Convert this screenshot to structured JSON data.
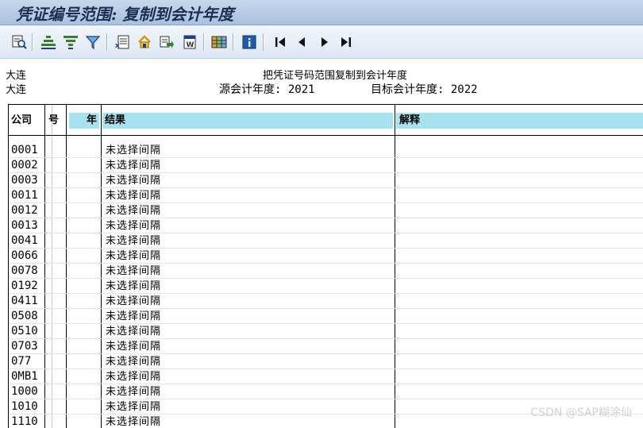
{
  "window": {
    "title": "凭证编号范围: 复制到会计年度"
  },
  "toolbar": {
    "buttons": [
      {
        "icon": "display-details-icon"
      },
      {
        "icon": "sort-ascending-icon"
      },
      {
        "icon": "sort-descending-icon"
      },
      {
        "icon": "filter-icon"
      },
      {
        "icon": "export-spreadsheet-icon"
      },
      {
        "icon": "local-file-icon"
      },
      {
        "icon": "send-icon"
      },
      {
        "icon": "word-processing-icon"
      },
      {
        "icon": "change-layout-icon"
      },
      {
        "icon": "information-icon"
      },
      {
        "icon": "first-page-icon"
      },
      {
        "icon": "previous-page-icon"
      },
      {
        "icon": "next-page-icon"
      },
      {
        "icon": "last-page-icon"
      }
    ]
  },
  "report": {
    "company_line1": "大连",
    "company_line2": "大连",
    "heading": "把凭证号码范围复制到会计年度",
    "source_year_label": "源会计年度:",
    "source_year": "2021",
    "target_year_label": "目标会计年度:",
    "target_year": "2022"
  },
  "table": {
    "columns": {
      "company": "公司",
      "number": "号",
      "year": "年",
      "result": "结果",
      "explanation": "解释"
    },
    "rows": [
      {
        "company": "0001",
        "result": "未选择间隔"
      },
      {
        "company": "0002",
        "result": "未选择间隔"
      },
      {
        "company": "0003",
        "result": "未选择间隔"
      },
      {
        "company": "0011",
        "result": "未选择间隔"
      },
      {
        "company": "0012",
        "result": "未选择间隔"
      },
      {
        "company": "0013",
        "result": "未选择间隔"
      },
      {
        "company": "0041",
        "result": "未选择间隔"
      },
      {
        "company": "0066",
        "result": "未选择间隔"
      },
      {
        "company": "0078",
        "result": "未选择间隔"
      },
      {
        "company": "0192",
        "result": "未选择间隔"
      },
      {
        "company": "0411",
        "result": "未选择间隔"
      },
      {
        "company": "0508",
        "result": "未选择间隔"
      },
      {
        "company": "0510",
        "result": "未选择间隔"
      },
      {
        "company": "0703",
        "result": "未选择间隔"
      },
      {
        "company": "077",
        "result": "未选择间隔"
      },
      {
        "company": "0MB1",
        "result": "未选择间隔"
      },
      {
        "company": "1000",
        "result": "未选择间隔"
      },
      {
        "company": "1010",
        "result": "未选择间隔"
      },
      {
        "company": "1110",
        "result": "未选择间隔"
      }
    ]
  },
  "watermark": "CSDN @SAP糊涂仙"
}
